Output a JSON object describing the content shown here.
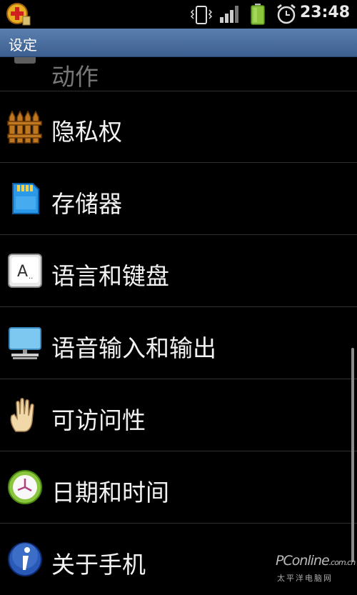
{
  "status_bar": {
    "time": "23:48",
    "icons": [
      "app-notification-icon",
      "vibrate-icon",
      "signal-icon",
      "battery-icon",
      "alarm-icon"
    ]
  },
  "title_bar": {
    "title": "设定"
  },
  "settings": {
    "items": [
      {
        "label": "动作",
        "icon": "motion-icon"
      },
      {
        "label": "隐私权",
        "icon": "fence-icon"
      },
      {
        "label": "存储器",
        "icon": "sd-card-icon"
      },
      {
        "label": "语言和键盘",
        "icon": "keyboard-key-icon"
      },
      {
        "label": "语音输入和输出",
        "icon": "monitor-icon"
      },
      {
        "label": "可访问性",
        "icon": "hand-icon"
      },
      {
        "label": "日期和时间",
        "icon": "clock-icon"
      },
      {
        "label": "关于手机",
        "icon": "info-icon"
      }
    ]
  },
  "watermark": {
    "brand": "PConline",
    "domain": ".com.cn",
    "subtitle": "太平洋电脑网"
  },
  "colors": {
    "title_bar": "#4a6d9e",
    "background": "#000000",
    "divider": "#2e2e2e"
  }
}
